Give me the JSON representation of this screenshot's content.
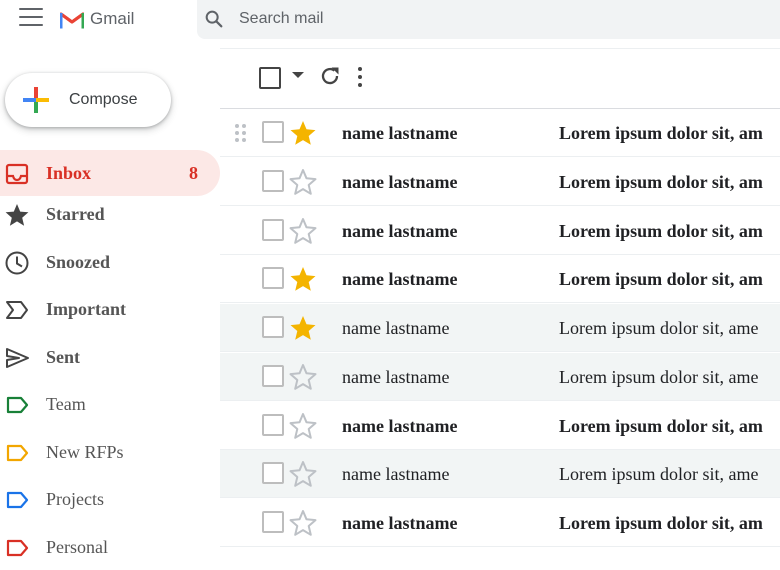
{
  "header": {
    "app_name": "Gmail",
    "search_placeholder": "Search mail"
  },
  "sidebar": {
    "compose_label": "Compose",
    "items": [
      {
        "label": "Inbox",
        "count": "8",
        "icon": "inbox-icon",
        "active": true,
        "bold": true
      },
      {
        "label": "Starred",
        "icon": "star-icon",
        "bold": true
      },
      {
        "label": "Snoozed",
        "icon": "clock-icon",
        "bold": true
      },
      {
        "label": "Important",
        "icon": "important-icon",
        "bold": true
      },
      {
        "label": "Sent",
        "icon": "send-icon",
        "bold": true
      },
      {
        "label": "Team",
        "icon": "label-icon",
        "color": "#188038"
      },
      {
        "label": "New RFPs",
        "icon": "label-icon",
        "color": "#f2a600"
      },
      {
        "label": "Projects",
        "icon": "label-icon",
        "color": "#1a73e8"
      },
      {
        "label": "Personal",
        "icon": "label-icon",
        "color": "#d93025"
      }
    ]
  },
  "colors": {
    "accent": "#d93025",
    "star": "#f4b400",
    "inbox_active_bg": "#fce8e6"
  },
  "emails": [
    {
      "sender": "name lastname",
      "subject": "Lorem ipsum dolor sit, am",
      "starred": true,
      "unread": true
    },
    {
      "sender": "name lastname",
      "subject": "Lorem ipsum dolor sit, am",
      "starred": false,
      "unread": true
    },
    {
      "sender": "name lastname",
      "subject": "Lorem ipsum dolor sit, am",
      "starred": false,
      "unread": true
    },
    {
      "sender": "name lastname",
      "subject": "Lorem ipsum dolor sit, am",
      "starred": true,
      "unread": true
    },
    {
      "sender": "name lastname",
      "subject": "Lorem ipsum dolor sit, ame",
      "starred": true,
      "unread": false
    },
    {
      "sender": "name lastname",
      "subject": "Lorem ipsum dolor sit, ame",
      "starred": false,
      "unread": false
    },
    {
      "sender": "name lastname",
      "subject": "Lorem ipsum dolor sit, am",
      "starred": false,
      "unread": true
    },
    {
      "sender": "name lastname",
      "subject": "Lorem ipsum dolor sit, ame",
      "starred": false,
      "unread": false
    },
    {
      "sender": "name lastname",
      "subject": "Lorem ipsum dolor sit, am",
      "starred": false,
      "unread": true
    }
  ]
}
